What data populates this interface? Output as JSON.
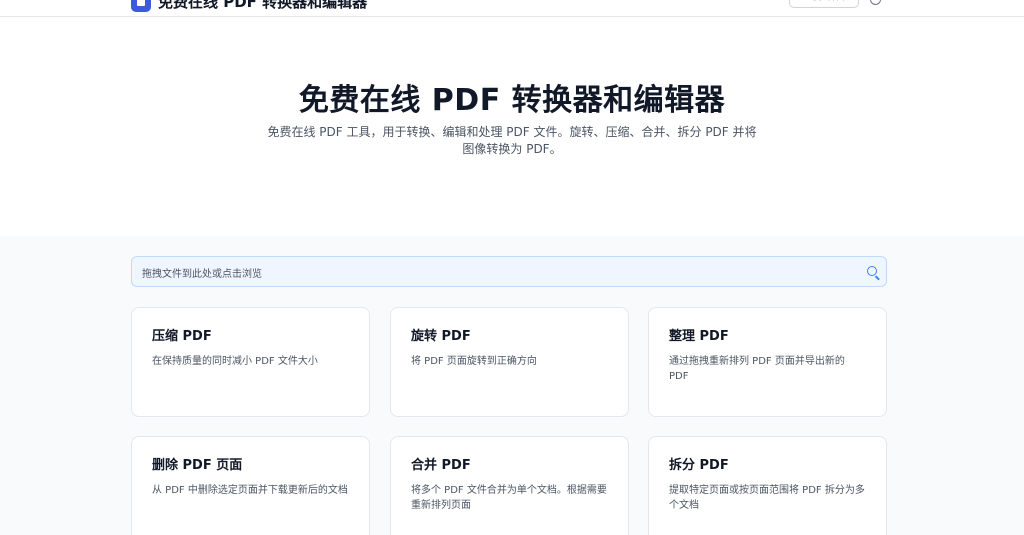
{
  "header": {
    "brand_name": "免费在线 PDF 转换器和编辑器",
    "language_button": "选择语言"
  },
  "hero": {
    "title": "免费在线 PDF 转换器和编辑器",
    "description": "免费在线 PDF 工具，用于转换、编辑和处理 PDF 文件。旋转、压缩、合并、拆分 PDF 并将图像转换为 PDF。"
  },
  "search": {
    "placeholder": "拖拽文件到此处或点击浏览"
  },
  "tools": [
    {
      "title": "压缩 PDF",
      "description": "在保持质量的同时减小 PDF 文件大小"
    },
    {
      "title": "旋转 PDF",
      "description": "将 PDF 页面旋转到正确方向"
    },
    {
      "title": "整理 PDF",
      "description": "通过拖拽重新排列 PDF 页面并导出新的 PDF"
    },
    {
      "title": "删除 PDF 页面",
      "description": "从 PDF 中删除选定页面并下载更新后的文档"
    },
    {
      "title": "合并 PDF",
      "description": "将多个 PDF 文件合并为单个文档。根据需要重新排列页面"
    },
    {
      "title": "拆分 PDF",
      "description": "提取特定页面或按页面范围将 PDF 拆分为多个文档"
    }
  ],
  "colors": {
    "accent": "#3b5bdb",
    "search_bg": "#eff6ff",
    "search_border": "#bfdbfe",
    "section_bg": "#f8fafc"
  }
}
